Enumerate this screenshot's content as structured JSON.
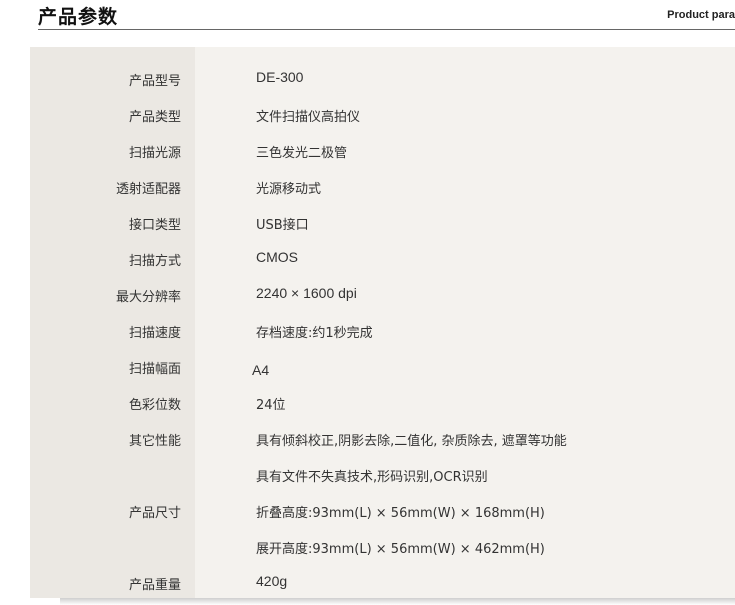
{
  "header": {
    "title": "产品参数",
    "subtitle": "Product para"
  },
  "specs": [
    {
      "label": "产品型号",
      "value": "DE-300"
    },
    {
      "label": "产品类型",
      "value": "文件扫描仪高拍仪"
    },
    {
      "label": "扫描光源",
      "value": "三色发光二极管"
    },
    {
      "label": "透射适配器",
      "value": "光源移动式"
    },
    {
      "label": "接口类型",
      "value": "USB接口"
    },
    {
      "label": "扫描方式",
      "value": "CMOS"
    },
    {
      "label": "最大分辨率",
      "value": "2240 × 1600 dpi"
    },
    {
      "label": "扫描速度",
      "value": "存档速度:约1秒完成"
    },
    {
      "label": "扫描幅面",
      "value": "A4"
    },
    {
      "label": "色彩位数",
      "value": "24位"
    },
    {
      "label": "其它性能",
      "value": "具有倾斜校正,阴影去除,二值化, 杂质除去, 遮罩等功能"
    },
    {
      "label": "",
      "value": "具有文件不失真技术,形码识别,OCR识别"
    },
    {
      "label": "产品尺寸",
      "value": "折叠高度:93mm(L) × 56mm(W) × 168mm(H)"
    },
    {
      "label": "",
      "value": "展开高度:93mm(L) × 56mm(W) × 462mm(H)"
    },
    {
      "label": "产品重量",
      "value": "420g"
    }
  ]
}
